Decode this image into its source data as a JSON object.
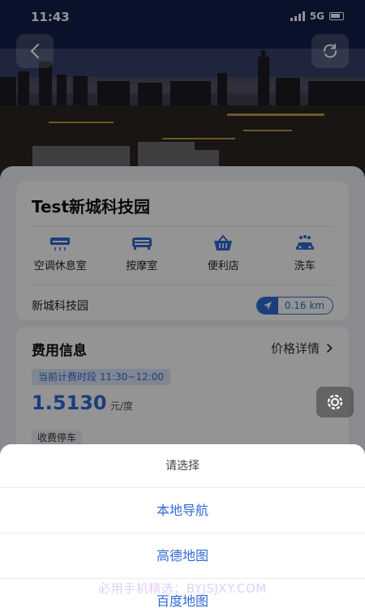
{
  "status_bar": {
    "time": "11:43",
    "network": "5G"
  },
  "header": {
    "back_icon": "chevron-left-icon",
    "share_icon": "refresh-icon"
  },
  "station": {
    "name": "Test新城科技园",
    "amenities": [
      {
        "label": "空调休息室",
        "icon": "air-conditioner-icon"
      },
      {
        "label": "按摩室",
        "icon": "massage-icon"
      },
      {
        "label": "便利店",
        "icon": "shopping-basket-icon"
      },
      {
        "label": "洗车",
        "icon": "car-wash-icon"
      }
    ],
    "address": "新城科技园",
    "distance": "0.16 km"
  },
  "fee": {
    "title": "费用信息",
    "detail_link": "价格详情",
    "period": "当前计费时段 11:30~12:00",
    "price": "1.5130",
    "unit": "元/度",
    "tag": "收费停车"
  },
  "action_sheet": {
    "title": "请选择",
    "options": [
      "本地导航",
      "高德地图",
      "百度地图"
    ]
  },
  "watermark": "必用手机精选：BYJSJXY.COM",
  "colors": {
    "accent": "#2f6bd6",
    "sheet_bg": "#ffffff",
    "page_bg": "#eef0f4"
  }
}
